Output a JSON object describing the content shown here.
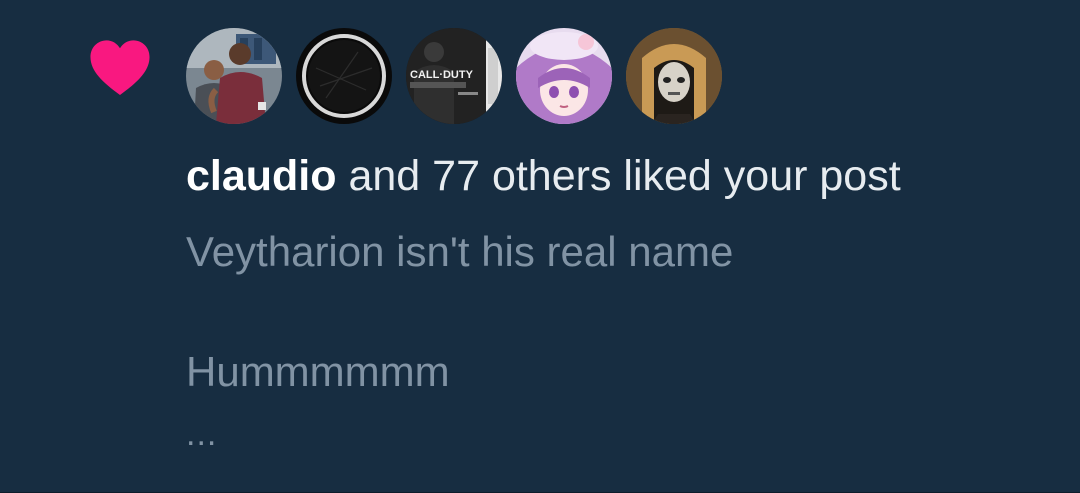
{
  "notification": {
    "type_icon": "heart-icon",
    "accent_color": "#f91880",
    "background_color": "#172d41",
    "avatars": [
      {
        "name": "liker-avatar-1",
        "description": "photo-two-people"
      },
      {
        "name": "liker-avatar-2",
        "description": "black-circle-ring"
      },
      {
        "name": "liker-avatar-3",
        "description": "game-cover-art",
        "text": "CALL·DUTY"
      },
      {
        "name": "liker-avatar-4",
        "description": "anime-character-purple"
      },
      {
        "name": "liker-avatar-5",
        "description": "masked-character"
      }
    ],
    "actor_name": "claudio",
    "action_text": " and 77 others liked your post",
    "post_preview": {
      "line1": "Veytharion isn't his real name",
      "line2": "",
      "line3": "Hummmmmm",
      "truncation": "..."
    }
  }
}
